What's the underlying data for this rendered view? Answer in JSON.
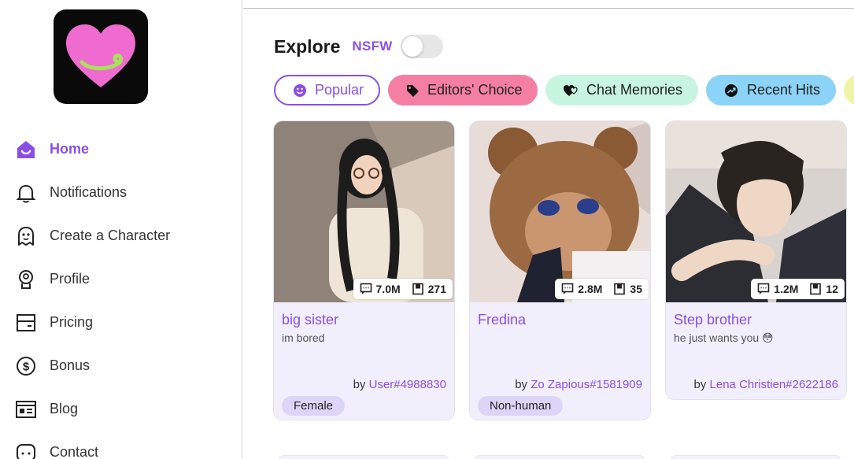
{
  "sidebar": {
    "logo_icon": "heart-logo-icon",
    "items": [
      {
        "label": "Home",
        "icon": "home-icon",
        "active": true
      },
      {
        "label": "Notifications",
        "icon": "bell-icon"
      },
      {
        "label": "Create a Character",
        "icon": "ghost-icon"
      },
      {
        "label": "Profile",
        "icon": "profile-badge-icon"
      },
      {
        "label": "Pricing",
        "icon": "card-icon"
      },
      {
        "label": "Bonus",
        "icon": "dollar-coin-icon"
      },
      {
        "label": "Blog",
        "icon": "newspaper-icon"
      },
      {
        "label": "Contact",
        "icon": "chat-bubble-icon"
      }
    ]
  },
  "main": {
    "title": "Explore",
    "nsfw_label": "NSFW",
    "nsfw_enabled": false,
    "chips": [
      {
        "label": "Popular",
        "icon": "smile-icon",
        "color": "#8a4ee6"
      },
      {
        "label": "Editors' Choice",
        "icon": "tag-icon",
        "color": "#f57fa2"
      },
      {
        "label": "Chat Memories",
        "icon": "hearts-icon",
        "color": "#c8f5df"
      },
      {
        "label": "Recent Hits",
        "icon": "trending-icon",
        "color": "#8bd3f7"
      }
    ],
    "cards": [
      {
        "name": "big sister",
        "desc": "im bored",
        "messages": "7.0M",
        "memories": "271",
        "by_prefix": "by",
        "author": "User#4988830",
        "tag": "Female"
      },
      {
        "name": "Fredina",
        "desc": "",
        "messages": "2.8M",
        "memories": "35",
        "by_prefix": "by",
        "author": "Zo Zapious#1581909",
        "tag": "Non-human"
      },
      {
        "name": "Step brother",
        "desc": "he just wants you 😳",
        "messages": "1.2M",
        "memories": "12",
        "by_prefix": "by",
        "author": "Lena Christien#2622186",
        "tag": ""
      }
    ]
  },
  "colors": {
    "accent": "#8a4ee6",
    "logo_heart": "#f06bd0"
  }
}
